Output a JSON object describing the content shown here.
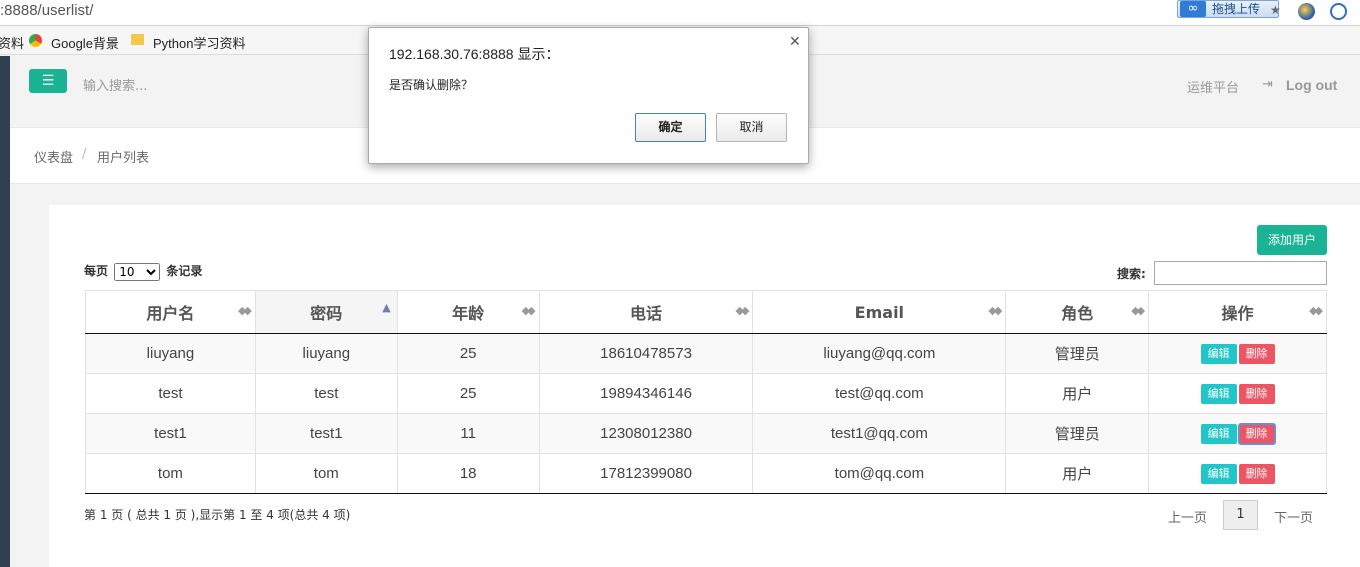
{
  "browser": {
    "url": ":8888/userlist/",
    "upload_label": "拖拽上传",
    "bookmarks": [
      "资料",
      "Google背景",
      "Python学习资料"
    ]
  },
  "topbar": {
    "search_placeholder": "输入搜索...",
    "platform": "运维平台",
    "logout": "Log out"
  },
  "breadcrumb": {
    "home": "仪表盘",
    "separator": "/",
    "current": "用户列表"
  },
  "panel": {
    "add_user": "添加用户",
    "per_page_prefix": "每页",
    "per_page_value": "10",
    "per_page_suffix": "条记录",
    "search_label": "搜索:",
    "columns": [
      "用户名",
      "密码",
      "年龄",
      "电话",
      "Email",
      "角色",
      "操作"
    ],
    "rows": [
      {
        "username": "liuyang",
        "password": "liuyang",
        "age": "25",
        "phone": "18610478573",
        "email": "liuyang@qq.com",
        "role": "管理员"
      },
      {
        "username": "test",
        "password": "test",
        "age": "25",
        "phone": "19894346146",
        "email": "test@qq.com",
        "role": "用户"
      },
      {
        "username": "test1",
        "password": "test1",
        "age": "11",
        "phone": "12308012380",
        "email": "test1@qq.com",
        "role": "管理员"
      },
      {
        "username": "tom",
        "password": "tom",
        "age": "18",
        "phone": "17812399080",
        "email": "tom@qq.com",
        "role": "用户"
      }
    ],
    "edit_label": "编辑",
    "delete_label": "删除",
    "info": "第 1 页 ( 总共 1 页 ),显示第 1 至 4 项(总共 4 项)",
    "prev": "上一页",
    "page": "1",
    "next": "下一页"
  },
  "dialog": {
    "title": "192.168.30.76:8888 显示：",
    "message": "是否确认删除？",
    "ok": "确定",
    "cancel": "取消"
  },
  "colors": {
    "primary": "#1ab394",
    "info": "#23c6c8",
    "danger": "#ed5565",
    "sidebar": "#2f4050"
  }
}
